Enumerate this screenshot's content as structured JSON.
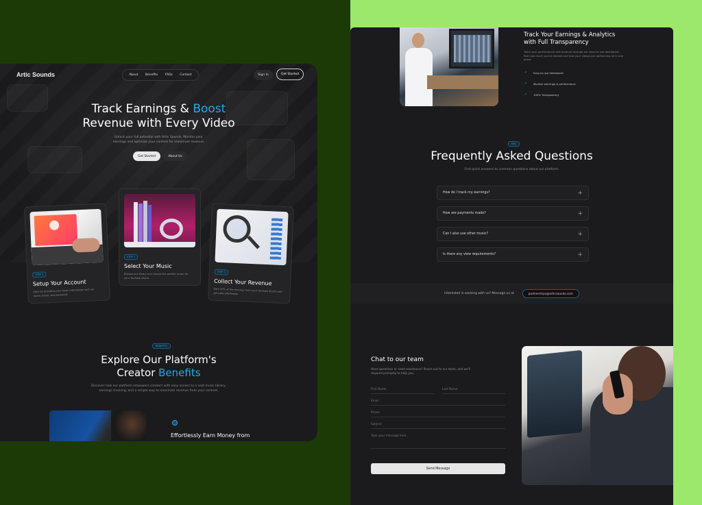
{
  "left": {
    "logo": "Artic Sounds",
    "nav": [
      "About",
      "Benefits",
      "FAQs",
      "Contact"
    ],
    "sign_in": "Sign In",
    "get_started_nav": "Get Started",
    "hero": {
      "title_line1": "Track Earnings & ",
      "title_accent": "Boost",
      "title_line2": "Revenue with Every Video",
      "subtitle": "Unlock your full potential with Artic Sounds. Monitor your earnings and optimize your content for maximum revenue.",
      "primary_button": "Get Started",
      "secondary_button": "About Us"
    },
    "steps": [
      {
        "badge": "STEP 1",
        "title": "Setup Your Account",
        "desc": "Start by providing your basic information such as name, email, and password."
      },
      {
        "badge": "STEP 2",
        "title": "Select Your Music",
        "desc": "Browse our library and choose the perfect music for your YouTube shorts."
      },
      {
        "badge": "STEP 3",
        "title": "Collect Your Revenue",
        "desc": "Earn 50% of the revenue from your YouTube Shorts and get paid effortlessly."
      }
    ],
    "benefits": {
      "badge": "BENEFITS",
      "title_line1": "Explore Our Platform's",
      "title_line2_plain": "Creator ",
      "title_line2_accent": "Benefits",
      "subtitle": "Discover how our platform empowers creators with easy access to a vast music library, earnings tracking, and a simple way to maximize revenue from your content.",
      "first_benefit_title": "Effortlessly Earn Money from"
    }
  },
  "right": {
    "analytics": {
      "title_line1": "Track Your Earnings & Analytics",
      "title_line2": "with Full Transparency",
      "desc": "Track your performance and revenue through our easy-to-use dashboard. See how much you've earned and how your videos are performing all in one place.",
      "checks": [
        "Easy-to-use dashboard",
        "Monitor earnings & performance",
        "100% Transparency"
      ]
    },
    "faq": {
      "badge": "FAQ",
      "title": "Frequently Asked Questions",
      "subtitle": "Find quick answers to common questions about our platform.",
      "items": [
        "How do I track my earnings?",
        "How are payments made?",
        "Can I also use other music?",
        "Is there any view requirements?"
      ]
    },
    "partner": {
      "text": "Interested in working with us? Message us at",
      "email": "partnerships@articsounds.com"
    },
    "chat": {
      "title": "Chat to our team",
      "desc": "Have questions or need assistance? Reach out to our team, and we'll respond promptly to help you.",
      "first_name": "First Name",
      "last_name": "Last Name",
      "email": "Email",
      "phone": "Phone",
      "subject": "Subject",
      "message": "Type your message here...",
      "send": "Send Message"
    }
  }
}
